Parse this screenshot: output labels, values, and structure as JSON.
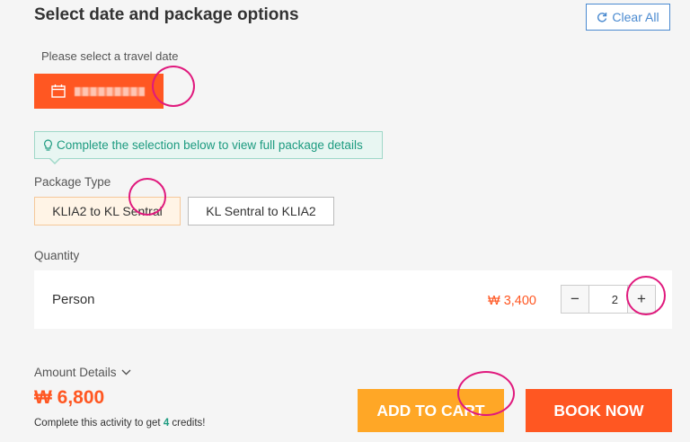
{
  "header": {
    "title": "Select date and package options",
    "clear_all": "Clear All"
  },
  "date": {
    "label": "Please select a travel date"
  },
  "notice": {
    "text": "Complete the selection below to view full package details"
  },
  "package": {
    "label": "Package Type",
    "options": [
      "KLIA2 to KL Sentral",
      "KL Sentral to KLIA2"
    ]
  },
  "quantity": {
    "label": "Quantity",
    "item": "Person",
    "price": "₩ 3,400",
    "value": "2",
    "minus": "−",
    "plus": "+"
  },
  "amount": {
    "label": "Amount Details",
    "total": "₩ 6,800",
    "credits_prefix": "Complete this activity to get ",
    "credits_value": "4",
    "credits_suffix": " credits!"
  },
  "actions": {
    "add_to_cart": "ADD TO CART",
    "book_now": "BOOK NOW"
  },
  "colors": {
    "accent": "#ff5722",
    "cart": "#ffa726",
    "link": "#4a8ad0",
    "success": "#1d9b80"
  }
}
